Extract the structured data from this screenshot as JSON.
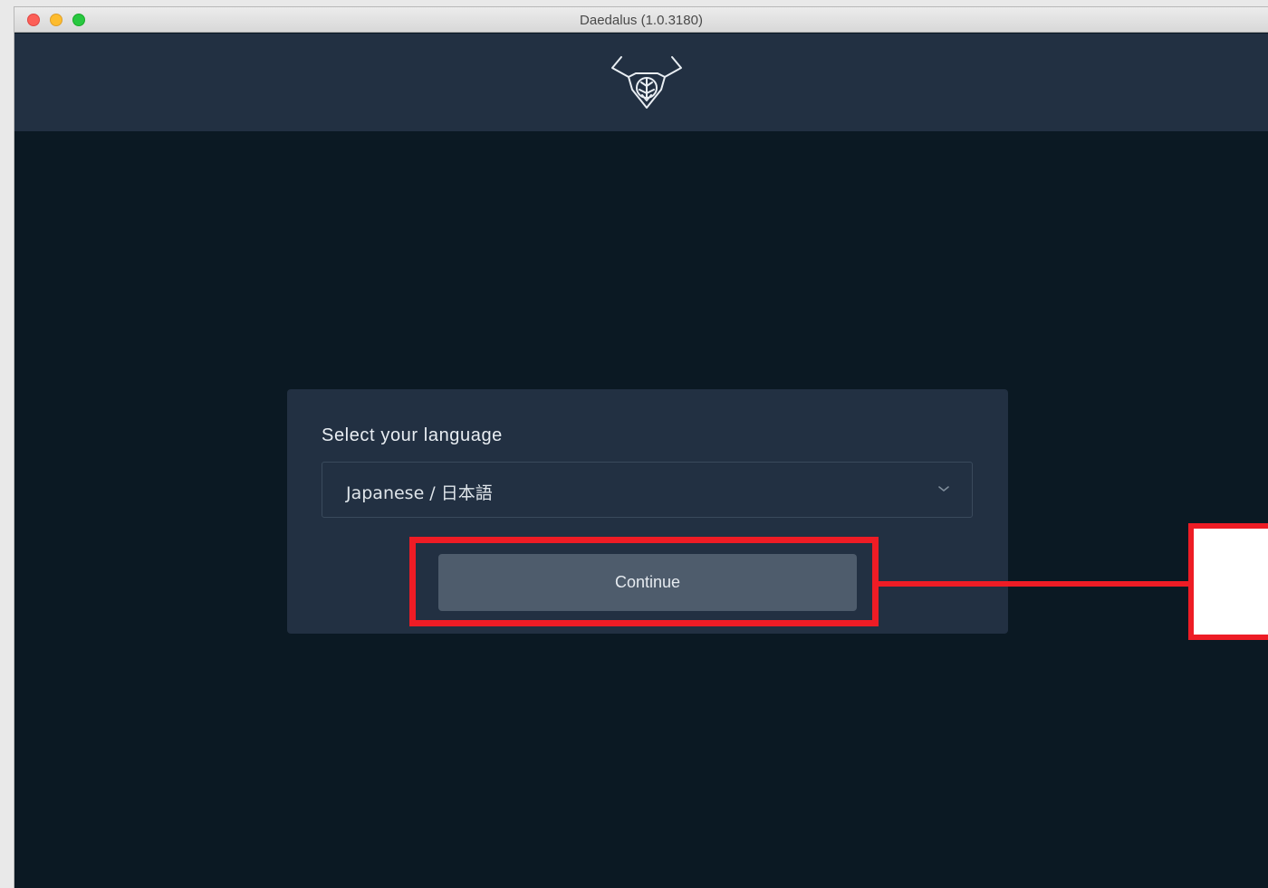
{
  "window": {
    "title": "Daedalus (1.0.3180)"
  },
  "language_card": {
    "label": "Select your language",
    "selected_language": "Japanese / 日本語",
    "continue_label": "Continue"
  },
  "annotation": {
    "callout_text": "「("
  },
  "colors": {
    "app_background": "#0b1923",
    "header_background": "#223042",
    "card_background": "#223042",
    "button_background": "#4e5c6c",
    "annotation_red": "#ee1c25"
  }
}
